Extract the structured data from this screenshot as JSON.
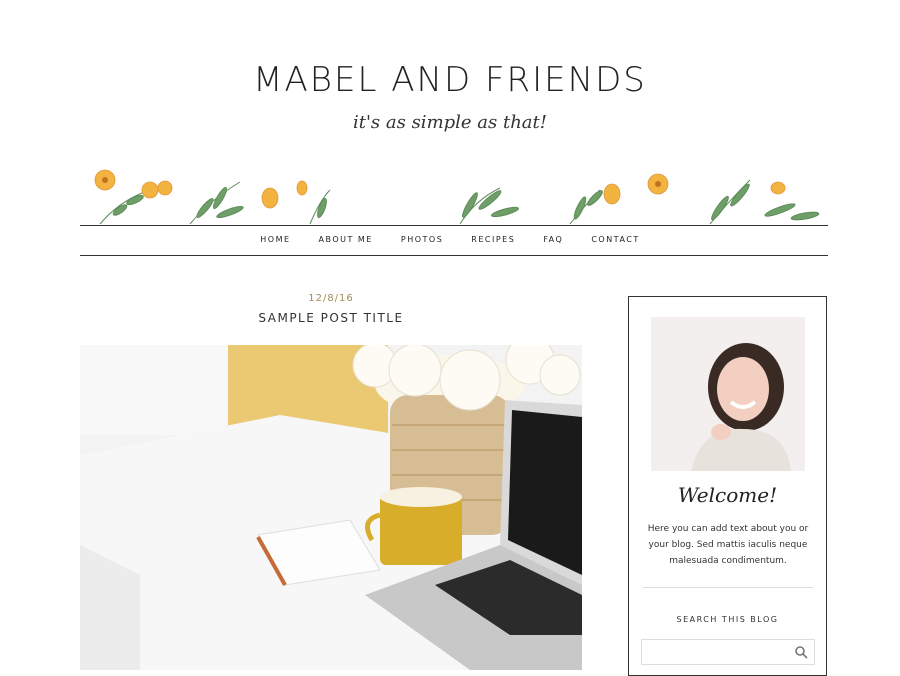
{
  "site": {
    "title": "MABEL AND FRIENDS",
    "tagline": "it's as simple as that!"
  },
  "nav": {
    "items": [
      "HOME",
      "ABOUT ME",
      "PHOTOS",
      "RECIPES",
      "FAQ",
      "CONTACT"
    ]
  },
  "post": {
    "date": "12/8/16",
    "title": "SAMPLE POST TITLE"
  },
  "sidebar": {
    "welcome": "Welcome!",
    "about_text": "Here you can add text about you or your blog. Sed mattis iaculis neque malesuada condimentum.",
    "search_title": "SEARCH THIS BLOG",
    "search_placeholder": ""
  },
  "colors": {
    "date_accent": "#a08a5a",
    "leaf_green": "#5e8c5a",
    "flower_yellow": "#f2b340",
    "line": "#333333"
  }
}
